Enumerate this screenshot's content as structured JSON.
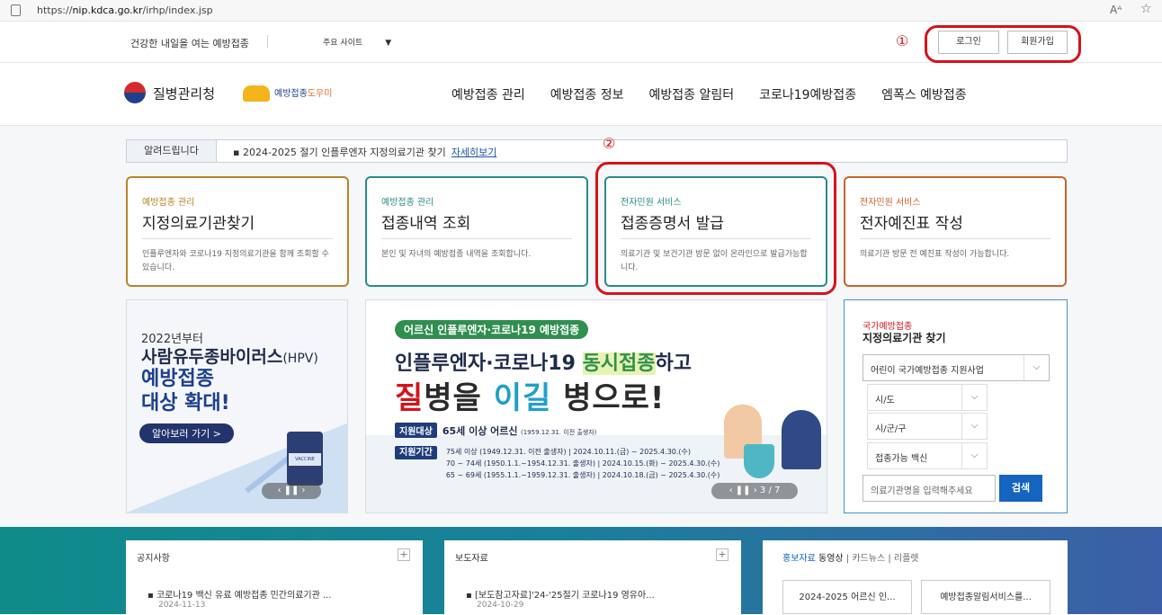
{
  "browser": {
    "url_prefix": "https://",
    "url_host": "nip.kdca.go.kr",
    "url_path": "/irhp/index.jsp",
    "reader_icon": "Aᴬ",
    "fav_icon": "☆"
  },
  "util": {
    "slogan": "건강한 내일을 여는 예방접종",
    "sites": "주요 사이트",
    "sites_caret": "▼",
    "marker": "①",
    "login": "로그인",
    "join": "회원가입"
  },
  "header": {
    "logo_main": "질병관리청",
    "logo_sub": "예방접종",
    "logo_sub_help": "도우미",
    "nav": [
      "예방접종 관리",
      "예방접종 정보",
      "예방접종 알림터",
      "코로나19예방접종",
      "엠폭스 예방접종"
    ]
  },
  "notice": {
    "tag": "알려드립니다",
    "bullet": "▪",
    "text": "2024-2025 절기 인플루엔자 지정의료기관 찾기",
    "link": "자세히보기",
    "marker": "②"
  },
  "cards": [
    {
      "cat": "예방접종 관리",
      "title": "지정의료기관찾기",
      "desc": "인플루엔자와 코로나19 지정의료기관을 함께 조회할 수 있습니다."
    },
    {
      "cat": "예방접종 관리",
      "title": "접종내역 조회",
      "desc": "본인 및 자녀의 예방접종 내역을 조회합니다."
    },
    {
      "cat": "전자민원 서비스",
      "title": "접종증명서 발급",
      "desc": "의료기관 및 보건기관 방문 없이 온라인으로 발급가능합니다."
    },
    {
      "cat": "전자민원 서비스",
      "title": "전자예진표 작성",
      "desc": "의료기관 방문 전 예진표 작성이 가능합니다."
    }
  ],
  "colors": {
    "card1": "#b8832c",
    "card2": "#2a8c85",
    "card3": "#2a8c85",
    "card4": "#c9642a",
    "red": "#d4131b",
    "blue": "#1565c0"
  },
  "banner1": {
    "line1": "2022년부터",
    "line2": "사람유두종바이러스",
    "line2b": "(HPV)",
    "line3": "예방접종",
    "line4": "대상 확대!",
    "button": "알아보러 가기  >",
    "vial": "VACCINE",
    "pager": "‹  ❚❚  ›"
  },
  "banner2": {
    "pill": "어르신 인플루엔자·코로나19 예방접종",
    "head_a": "인플루엔자·코로나19 ",
    "head_b": "동시접종",
    "head_c": "하고",
    "big_a": "질",
    "big_b": "병을 ",
    "big_c": "이길",
    "big_d": " 병으로!",
    "label1": "지원대상",
    "target": "65세 이상 어르신",
    "target_note": "(1959.12.31. 이전 출생자)",
    "label2": "지원기간",
    "rows": [
      "75세 이상 (1949.12.31. 이전 출생자)  |  2024.10.11.(금) ~ 2025.4.30.(수)",
      "70 ~ 74세 (1950.1.1.~1954.12.31. 출생자)  |  2024.10.15.(화) ~ 2025.4.30.(수)",
      "65 ~ 69세 (1955.1.1.~1959.12.31. 출생자)  |  2024.10.18.(금) ~ 2025.4.30.(수)"
    ],
    "pager": "‹  ❚❚  ›  3 / 7"
  },
  "finder": {
    "kicker": "국가예방접종",
    "title": "지정의료기관 찾기",
    "select1": "어린이 국가예방접종 지원사업",
    "select2": "시/도",
    "select3": "시/군/구",
    "select4": "접종가능 백신",
    "chev": "⌵",
    "placeholder": "의료기관명을 입력해주세요",
    "search": "검색"
  },
  "panels": {
    "notice": {
      "title": "공지사항",
      "plus": "+",
      "item": "코로나19 백신 유료 예방접종 민간의료기관 ...",
      "date": "2024-11-13"
    },
    "press": {
      "title": "보도자료",
      "plus": "+",
      "item": "[보도참고자료]'24-'25절기 코로나19 영유아...",
      "date": "2024-10-29"
    },
    "promo": {
      "tab1": "홍보자료",
      "tab2": "동영상",
      "tab3": "카드뉴스",
      "tab4": "리플렛",
      "sep": " | ",
      "box1": "2024-2025 어르신 인...",
      "box2": "예방접종알림서비스를..."
    }
  }
}
